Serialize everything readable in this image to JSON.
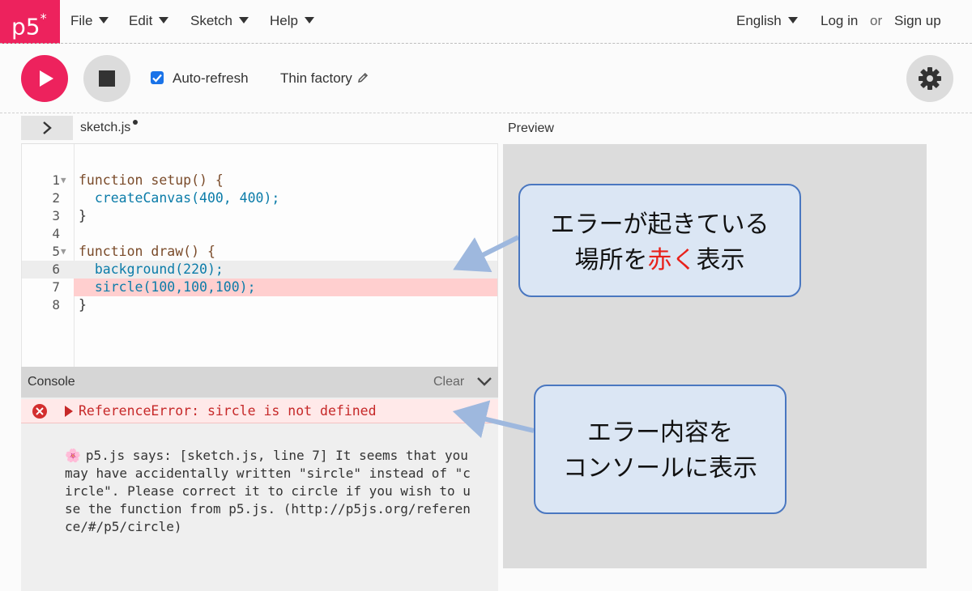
{
  "nav": {
    "logo": "p5",
    "logo_mark": "*",
    "menus": [
      "File",
      "Edit",
      "Sketch",
      "Help"
    ],
    "language": "English",
    "login": "Log in",
    "or": "or",
    "signup": "Sign up"
  },
  "toolbar": {
    "play_icon": "play-icon",
    "stop_icon": "stop-icon",
    "settings_icon": "gear-icon",
    "auto_refresh_label": "Auto-refresh",
    "auto_refresh_checked": true,
    "sketch_name": "Thin factory"
  },
  "editor": {
    "file_name": "sketch.js",
    "unsaved": true,
    "lines": [
      {
        "n": "1",
        "text": "function setup() {"
      },
      {
        "n": "2",
        "text": "  createCanvas(400, 400);"
      },
      {
        "n": "3",
        "text": "}"
      },
      {
        "n": "4",
        "text": ""
      },
      {
        "n": "5",
        "text": "function draw() {"
      },
      {
        "n": "6",
        "text": "  background(220);"
      },
      {
        "n": "7",
        "text": "  sircle(100,100,100);"
      },
      {
        "n": "8",
        "text": "}"
      }
    ]
  },
  "console": {
    "title": "Console",
    "clear": "Clear",
    "error": "ReferenceError: sircle is not defined",
    "p5_message": "p5.js says: [sketch.js, line 7] It seems that you may have accidentally written \"sircle\" instead of \"circle\". Please correct it to circle if you wish to use the function from p5.js. (http://p5js.org/reference/#/p5/circle)"
  },
  "preview": {
    "label": "Preview"
  },
  "annotations": {
    "callout1_line1": "エラーが起きている",
    "callout1_prefix": "場所を",
    "callout1_red": "赤く",
    "callout1_suffix": "表示",
    "callout2_line1": "エラー内容を",
    "callout2_line2": "コンソールに表示"
  },
  "colors": {
    "brand": "#ed225d",
    "error_highlight": "#ffcfcf",
    "error_text": "#c62828",
    "callout_fill": "#dbe6f4",
    "callout_border": "#4a77c0",
    "emphasis_red": "#e8211b"
  }
}
